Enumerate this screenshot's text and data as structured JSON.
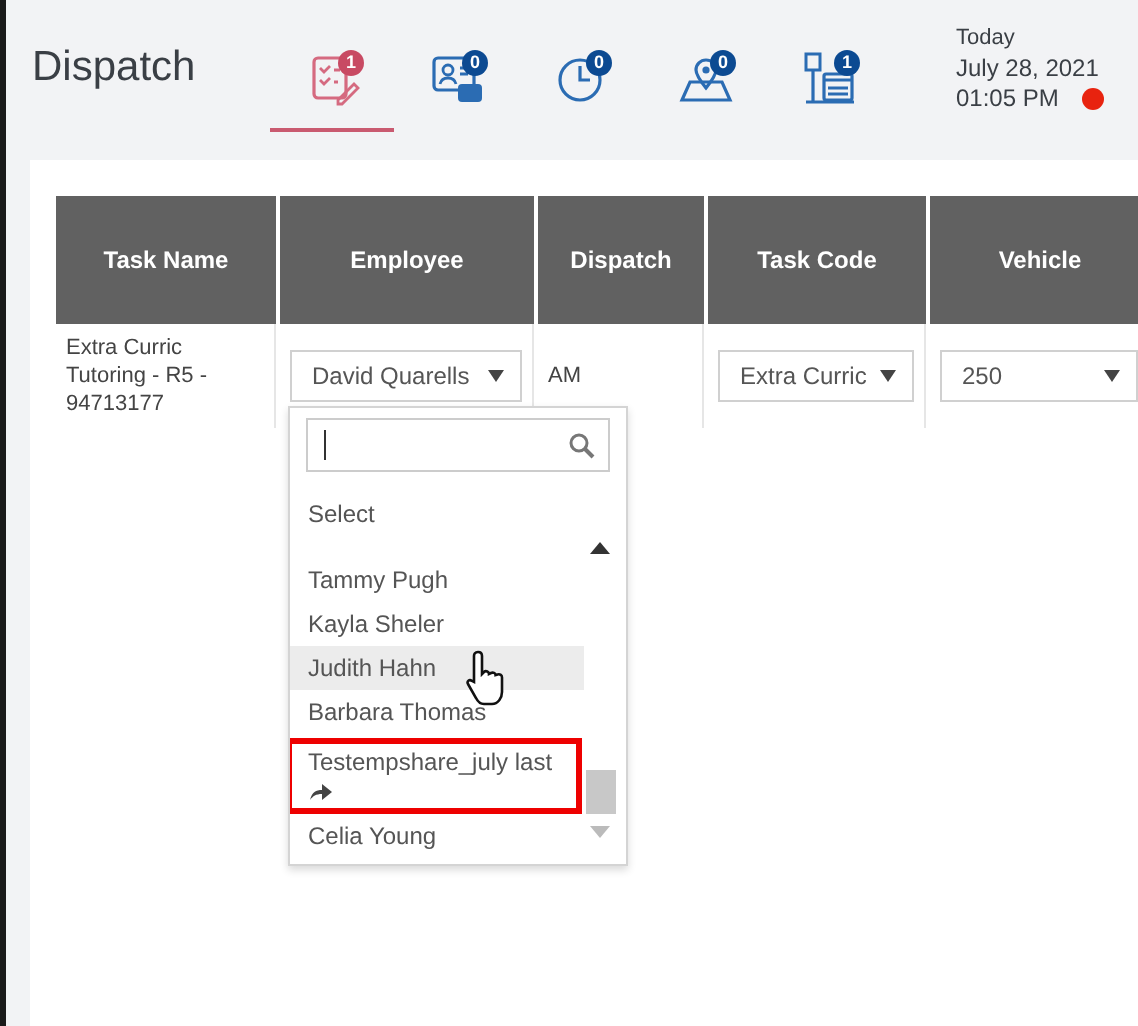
{
  "header": {
    "title": "Dispatch",
    "tabs": [
      {
        "kind": "checklist",
        "badge": "1",
        "selected": true
      },
      {
        "kind": "profile",
        "badge": "0",
        "selected": false
      },
      {
        "kind": "clock",
        "badge": "0",
        "selected": false
      },
      {
        "kind": "map",
        "badge": "0",
        "selected": false
      },
      {
        "kind": "parking",
        "badge": "1",
        "selected": false
      }
    ],
    "today_label": "Today",
    "date": "July 28, 2021",
    "time": "01:05 PM"
  },
  "table": {
    "columns": [
      "Task Name",
      "Employee",
      "Dispatch",
      "Task Code",
      "Vehicle"
    ],
    "rows": [
      {
        "task_name": "Extra Curric Tutoring - R5 - 94713177",
        "employee": "David Quarells",
        "dispatch": "AM",
        "task_code": "Extra Curric",
        "vehicle": "250"
      }
    ]
  },
  "employee_dropdown": {
    "first_option": "Select",
    "options": [
      {
        "label": "Tammy Pugh",
        "hovered": false,
        "shared": false,
        "annotated": false
      },
      {
        "label": "Kayla Sheler",
        "hovered": false,
        "shared": false,
        "annotated": false
      },
      {
        "label": "Judith Hahn",
        "hovered": true,
        "shared": false,
        "annotated": false
      },
      {
        "label": "Barbara Thomas",
        "hovered": false,
        "shared": false,
        "annotated": false
      },
      {
        "label": "Testempshare_july last",
        "hovered": false,
        "shared": true,
        "annotated": true
      },
      {
        "label": "Celia Young",
        "hovered": false,
        "shared": false,
        "annotated": false
      }
    ]
  }
}
